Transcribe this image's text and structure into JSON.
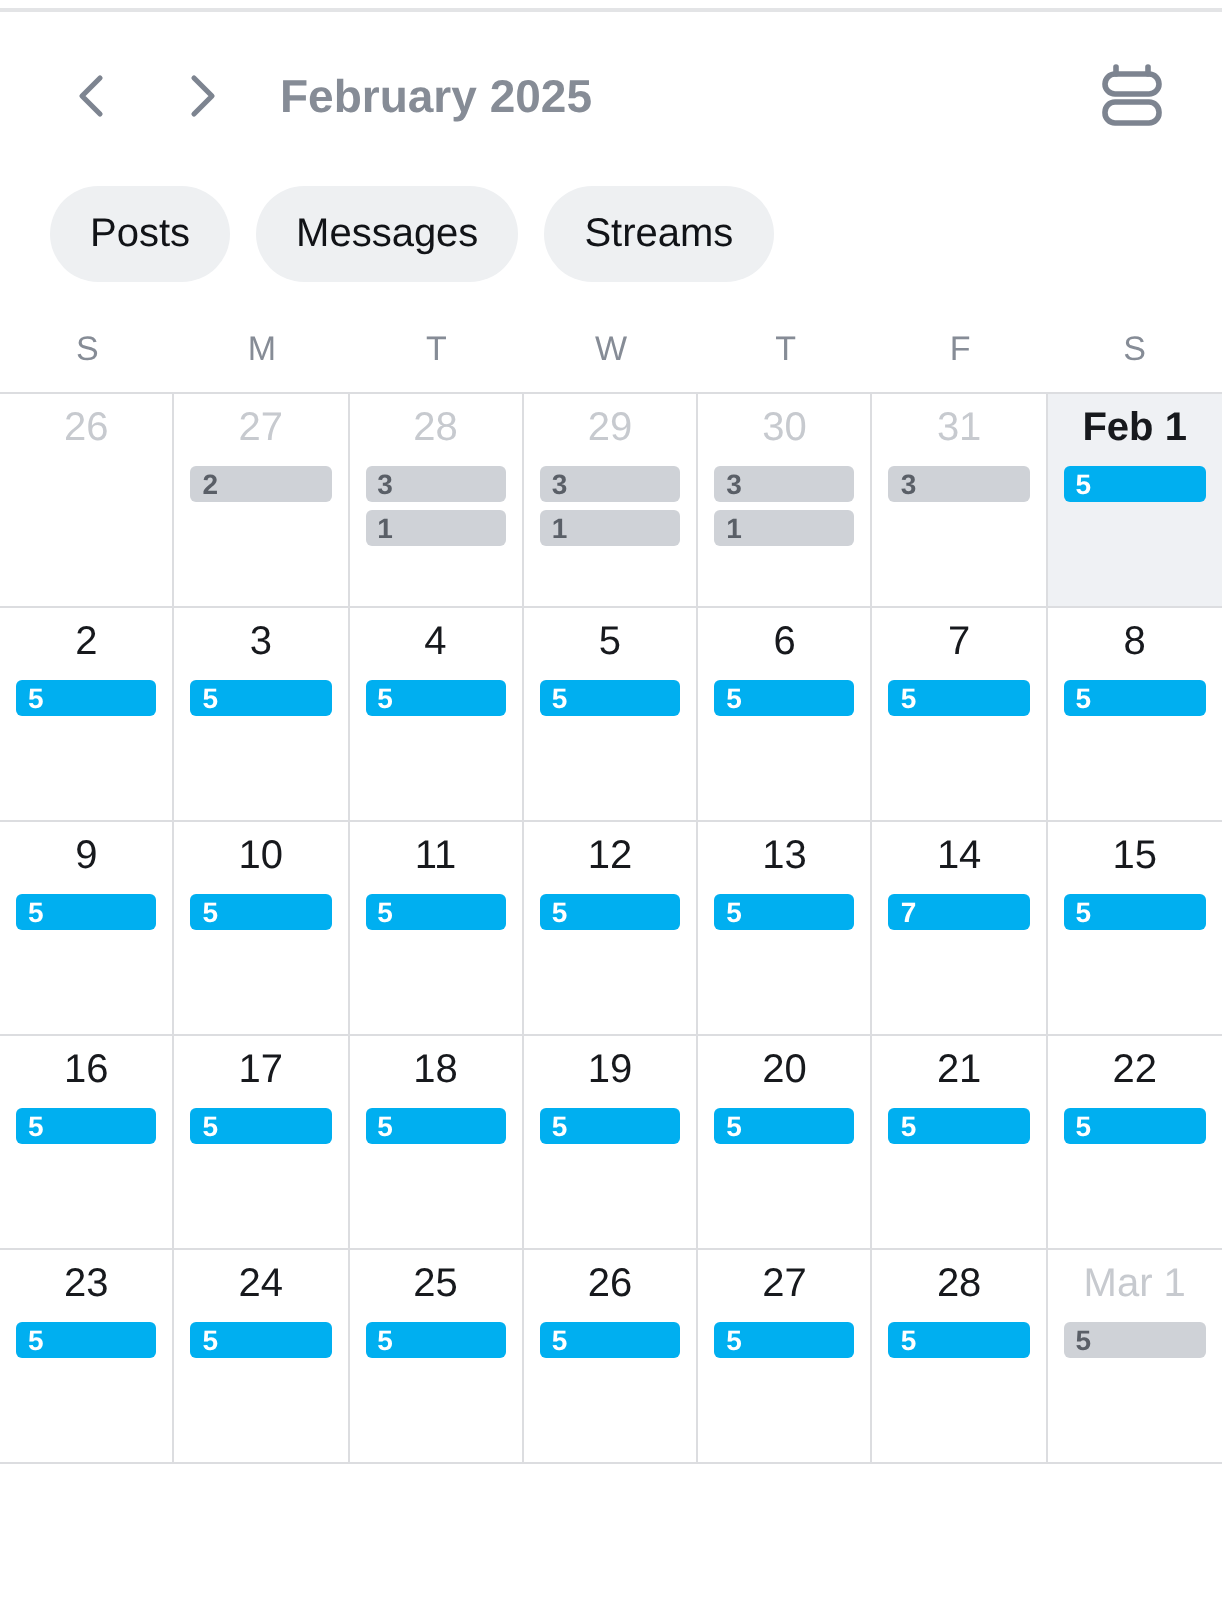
{
  "header": {
    "title": "February 2025"
  },
  "filters": [
    {
      "label": "Posts",
      "selected": false
    },
    {
      "label": "Messages",
      "selected": false
    },
    {
      "label": "Streams",
      "selected": false
    }
  ],
  "weekdays": [
    "S",
    "M",
    "T",
    "W",
    "T",
    "F",
    "S"
  ],
  "weeks": [
    {
      "days": [
        {
          "label": "26",
          "outside_month": true,
          "selected": false
        },
        {
          "label": "27",
          "outside_month": true,
          "selected": false,
          "badges": [
            "2"
          ]
        },
        {
          "label": "28",
          "outside_month": true,
          "selected": false,
          "badges": [
            "3",
            "1"
          ]
        },
        {
          "label": "29",
          "outside_month": true,
          "selected": false,
          "badges": [
            "3",
            "1"
          ]
        },
        {
          "label": "30",
          "outside_month": true,
          "selected": false,
          "badges": [
            "3",
            "1"
          ]
        },
        {
          "label": "31",
          "outside_month": true,
          "selected": false,
          "badges": [
            "3"
          ]
        },
        {
          "label": "Feb 1",
          "outside_month": false,
          "selected": true,
          "badges": [
            "5"
          ]
        }
      ]
    },
    {
      "days": [
        {
          "label": "2",
          "outside_month": false,
          "selected": false,
          "badges": [
            "5"
          ]
        },
        {
          "label": "3",
          "outside_month": false,
          "selected": false,
          "badges": [
            "5"
          ]
        },
        {
          "label": "4",
          "outside_month": false,
          "selected": false,
          "badges": [
            "5"
          ]
        },
        {
          "label": "5",
          "outside_month": false,
          "selected": false,
          "badges": [
            "5"
          ]
        },
        {
          "label": "6",
          "outside_month": false,
          "selected": false,
          "badges": [
            "5"
          ]
        },
        {
          "label": "7",
          "outside_month": false,
          "selected": false,
          "badges": [
            "5"
          ]
        },
        {
          "label": "8",
          "outside_month": false,
          "selected": false,
          "badges": [
            "5"
          ]
        }
      ]
    },
    {
      "days": [
        {
          "label": "9",
          "outside_month": false,
          "selected": false,
          "badges": [
            "5"
          ]
        },
        {
          "label": "10",
          "outside_month": false,
          "selected": false,
          "badges": [
            "5"
          ]
        },
        {
          "label": "11",
          "outside_month": false,
          "selected": false,
          "badges": [
            "5"
          ]
        },
        {
          "label": "12",
          "outside_month": false,
          "selected": false,
          "badges": [
            "5"
          ]
        },
        {
          "label": "13",
          "outside_month": false,
          "selected": false,
          "badges": [
            "5"
          ]
        },
        {
          "label": "14",
          "outside_month": false,
          "selected": false,
          "badges": [
            "7"
          ]
        },
        {
          "label": "15",
          "outside_month": false,
          "selected": false,
          "badges": [
            "5"
          ]
        }
      ]
    },
    {
      "days": [
        {
          "label": "16",
          "outside_month": false,
          "selected": false,
          "badges": [
            "5"
          ]
        },
        {
          "label": "17",
          "outside_month": false,
          "selected": false,
          "badges": [
            "5"
          ]
        },
        {
          "label": "18",
          "outside_month": false,
          "selected": false,
          "badges": [
            "5"
          ]
        },
        {
          "label": "19",
          "outside_month": false,
          "selected": false,
          "badges": [
            "5"
          ]
        },
        {
          "label": "20",
          "outside_month": false,
          "selected": false,
          "badges": [
            "5"
          ]
        },
        {
          "label": "21",
          "outside_month": false,
          "selected": false,
          "badges": [
            "5"
          ]
        },
        {
          "label": "22",
          "outside_month": false,
          "selected": false,
          "badges": [
            "5"
          ]
        }
      ]
    },
    {
      "days": [
        {
          "label": "23",
          "outside_month": false,
          "selected": false,
          "badges": [
            "5"
          ]
        },
        {
          "label": "24",
          "outside_month": false,
          "selected": false,
          "badges": [
            "5"
          ]
        },
        {
          "label": "25",
          "outside_month": false,
          "selected": false,
          "badges": [
            "5"
          ]
        },
        {
          "label": "26",
          "outside_month": false,
          "selected": false,
          "badges": [
            "5"
          ]
        },
        {
          "label": "27",
          "outside_month": false,
          "selected": false,
          "badges": [
            "5"
          ]
        },
        {
          "label": "28",
          "outside_month": false,
          "selected": false,
          "badges": [
            "5"
          ]
        },
        {
          "label": "Mar 1",
          "outside_month": true,
          "selected": false,
          "badges": [
            "5"
          ]
        }
      ]
    }
  ]
}
